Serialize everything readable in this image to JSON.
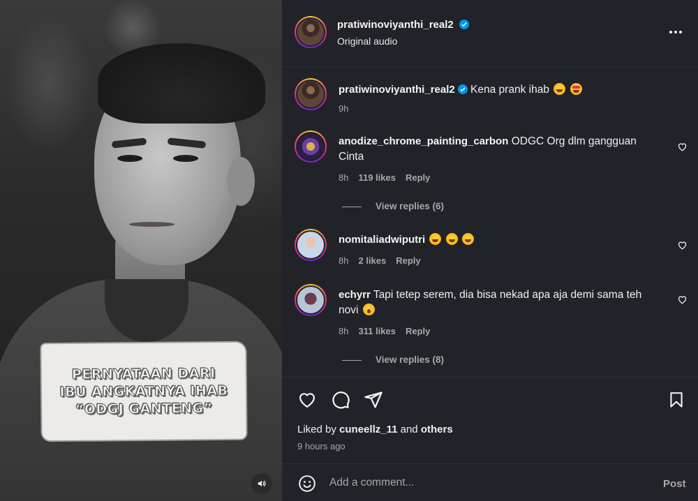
{
  "media": {
    "overlay_lines": [
      "PERNYATAAN DARI",
      "IBU ANGKATNYA IHAB",
      "“ODGJ GANTENG”"
    ],
    "sound_icon": "speaker-icon"
  },
  "header": {
    "username": "pratiwinoviyanthi_real2",
    "verified": true,
    "audio": "Original audio",
    "more_icon": "more-options-icon"
  },
  "caption": {
    "username": "pratiwinoviyanthi_real2",
    "verified": true,
    "text": "Kena prank ihab",
    "emojis": [
      "rolling-laughing",
      "heart-eyes"
    ],
    "time": "9h"
  },
  "comments": [
    {
      "username": "anodize_chrome_painting_carbon",
      "text_line1": "ODGC Org dlm gangguan",
      "text_line2": "Cinta",
      "time": "8h",
      "likes": "119 likes",
      "reply": "Reply",
      "view_replies": "View replies (6)"
    },
    {
      "username": "nomitaliadwiputri",
      "text": "",
      "emojis": [
        "laughing",
        "laughing",
        "laughing"
      ],
      "time": "8h",
      "likes": "2 likes",
      "reply": "Reply"
    },
    {
      "username": "echyrr",
      "text_line1": "Tapi tetep serem, dia bisa nekad apa aja demi sama teh",
      "text_line2": "novi",
      "emojis": [
        "astonished"
      ],
      "time": "8h",
      "likes": "311 likes",
      "reply": "Reply",
      "view_replies": "View replies (8)"
    }
  ],
  "actions": {
    "like_icon": "heart-icon",
    "comment_icon": "comment-icon",
    "share_icon": "share-icon",
    "save_icon": "bookmark-icon",
    "liked_by_prefix": "Liked by",
    "liked_by_user": "cuneellz_11",
    "liked_by_and": "and",
    "liked_by_others": "others",
    "time_ago": "9 hours ago"
  },
  "composer": {
    "emoji_icon": "emoji-icon",
    "placeholder": "Add a comment...",
    "post_label": "Post"
  },
  "colors": {
    "panel_bg": "#212328",
    "verified_blue": "#0095f6",
    "muted_text": "#a8a8a8"
  }
}
